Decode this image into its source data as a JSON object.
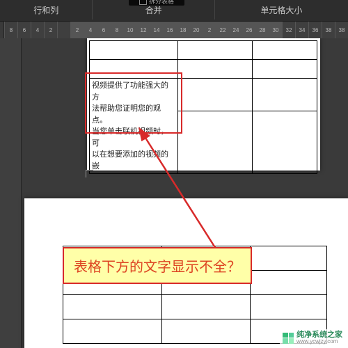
{
  "toolbar": {
    "group_rows_cols": "行和列",
    "group_merge": "合并",
    "group_cell_size": "单元格大小",
    "dark_box_label": "拆分表格"
  },
  "ruler": {
    "ticks": [
      "8",
      "6",
      "4",
      "2",
      "",
      "2",
      "4",
      "6",
      "8",
      "10",
      "12",
      "14",
      "16",
      "18",
      "20",
      "2",
      "22",
      "24",
      "26",
      "28",
      "30",
      "32",
      "34",
      "36",
      "38",
      "38"
    ]
  },
  "cell_text": {
    "line1": "视频提供了功能强大的方",
    "line2": "法帮助您证明您的观点。",
    "line3": "当您单击联机视频时，可",
    "line4": "以在想要添加的视频的嵌"
  },
  "annotation_text": "表格下方的文字显示不全？",
  "watermark": {
    "name": "纯净系统之家",
    "url": "www.ycwjzy.com"
  }
}
